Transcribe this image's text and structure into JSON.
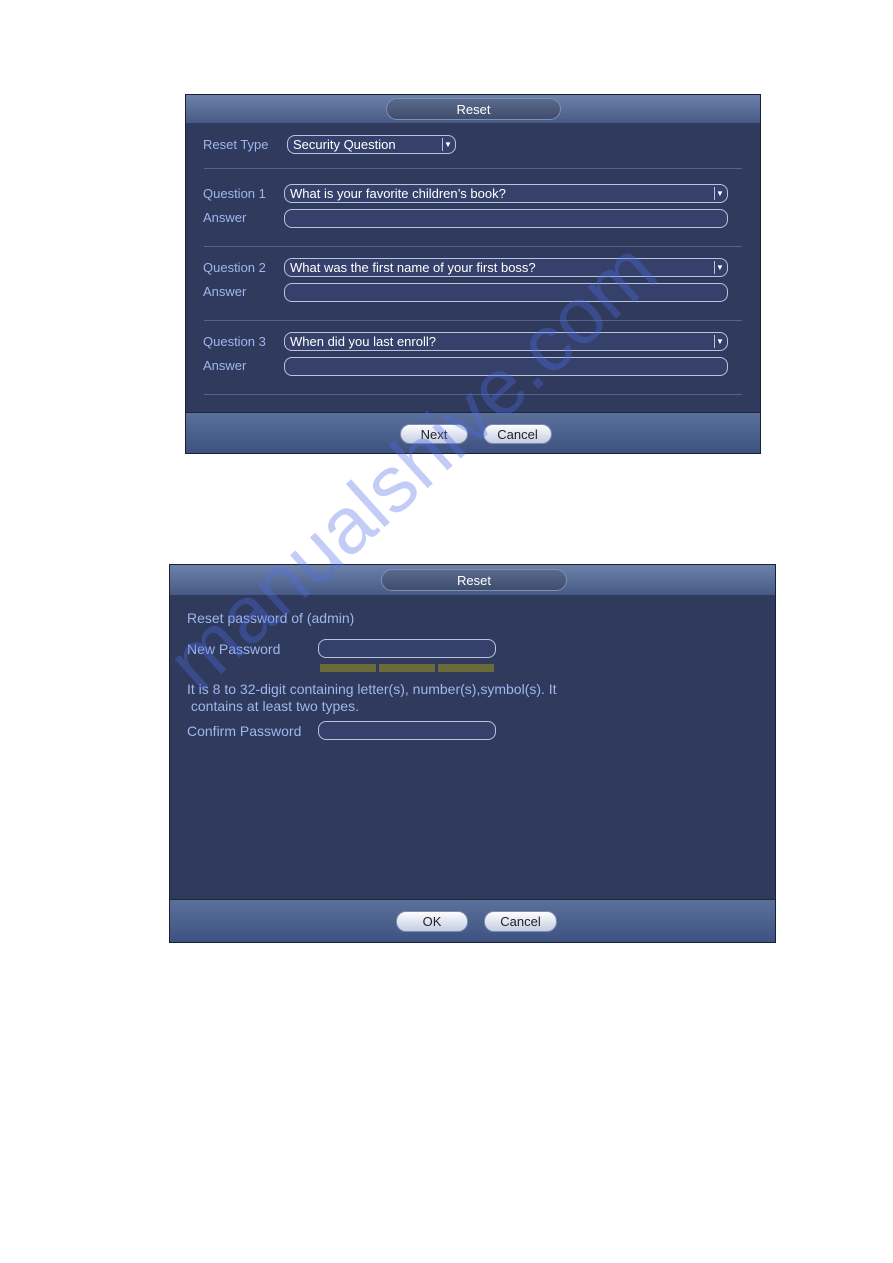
{
  "dialog1": {
    "title": "Reset",
    "reset_type_label": "Reset Type",
    "reset_type_value": "Security Question",
    "questions": [
      {
        "label": "Question 1",
        "value": "What is your favorite children’s book?",
        "answer_label": "Answer",
        "answer": ""
      },
      {
        "label": "Question 2",
        "value": "What was the first name of your first boss?",
        "answer_label": "Answer",
        "answer": ""
      },
      {
        "label": "Question 3",
        "value": "When did you last enroll?",
        "answer_label": "Answer",
        "answer": ""
      }
    ],
    "next_label": "Next",
    "cancel_label": "Cancel"
  },
  "dialog2": {
    "title": "Reset",
    "reset_text": "Reset password of (admin)",
    "new_password_label": "New Password",
    "hint_line1": "It is 8 to 32-digit containing letter(s), number(s),symbol(s). It",
    "hint_line2": " contains at least two types.",
    "confirm_password_label": "Confirm Password",
    "ok_label": "OK",
    "cancel_label": "Cancel",
    "strength_color": "#6b6a3a"
  },
  "watermark": "manualshive.com"
}
